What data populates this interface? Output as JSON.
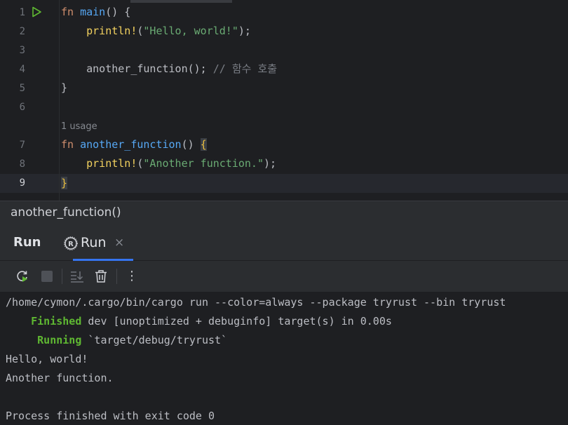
{
  "editor": {
    "line_numbers": [
      "1",
      "2",
      "3",
      "4",
      "5",
      "6",
      "7",
      "8",
      "9"
    ],
    "lines": {
      "l1": {
        "kw": "fn",
        "name": "main",
        "rest": "() {"
      },
      "l2": {
        "macro": "println!",
        "open": "(",
        "str": "\"Hello, world!\"",
        "close": ");"
      },
      "l4": {
        "call": "another_function();",
        "comment": "// 함수 호출"
      },
      "l5": {
        "text": "}"
      },
      "l7": {
        "kw": "fn",
        "name": "another_function",
        "rest": "() ",
        "brace": "{"
      },
      "l8": {
        "macro": "println!",
        "open": "(",
        "str": "\"Another function.\"",
        "close": ");"
      },
      "l9": {
        "brace": "}"
      }
    },
    "usage_hint": "1 usage"
  },
  "breadcrumb": "another_function()",
  "run_panel": {
    "title": "Run",
    "tab_label": "Run",
    "close_glyph": "×",
    "toolbar_icons": [
      "rerun-icon",
      "stop-icon",
      "scroll-to-end-icon",
      "clear-icon",
      "more-icon"
    ],
    "more_glyph": "⋮"
  },
  "console": {
    "command": "/home/cymon/.cargo/bin/cargo run --color=always --package tryrust --bin tryrust",
    "finished_label": "Finished",
    "finished_text": " dev [unoptimized + debuginfo] target(s) in 0.00s",
    "running_label": "Running",
    "running_text": " `target/debug/tryrust`",
    "output1": "Hello, world!",
    "output2": "Another function.",
    "exit": "Process finished with exit code 0"
  },
  "colors": {
    "accent": "#3574f0",
    "success": "#5fb832",
    "keyword": "#cf8e6d",
    "function": "#56a8f5",
    "macro": "#f2d15f",
    "string": "#6aab73"
  }
}
